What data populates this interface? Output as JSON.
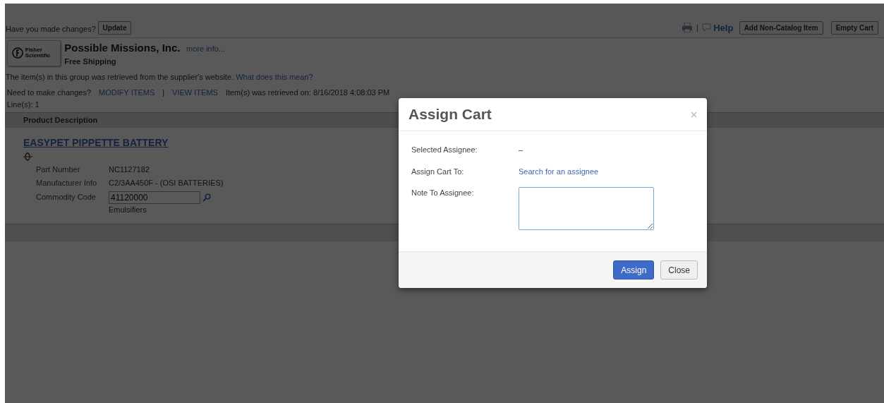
{
  "toolbar": {
    "prompt": "Have you made changes?",
    "update_button": "Update",
    "separator": "|",
    "help_link": "Help",
    "buttons": [
      "Add Non-Catalog Item",
      "Empty Cart"
    ]
  },
  "supplier": {
    "logo_text": "Fisher Scientific",
    "name": "Possible Missions, Inc.",
    "more_link": "more info...",
    "shipping": "Free Shipping"
  },
  "notice": {
    "text": "The item(s) in this group was retrieved from the supplier's website.",
    "link": "What does this mean?"
  },
  "changes": {
    "prompt": "Need to make changes?",
    "links": [
      "MODIFY ITEMS",
      "VIEW ITEMS"
    ],
    "separator": "|",
    "retrieved": "Item(s) was retrieved on: 8/16/2018 4:08:03 PM"
  },
  "lines": "Line(s): 1",
  "table": {
    "columns": [
      "Product Description"
    ]
  },
  "product": {
    "title": "EASYPET PIPPETTE BATTERY",
    "details": [
      {
        "label": "Part Number",
        "value": "NC1127182",
        "kind": "text"
      },
      {
        "label": "Manufacturer Info",
        "value": "C2/3AA450F - (OSI BATTERIES)",
        "kind": "text"
      },
      {
        "label": "Commodity Code",
        "value": "41120000",
        "kind": "field",
        "note": "Emulsifiers"
      }
    ]
  },
  "dialog": {
    "title": "Assign Cart",
    "rows": [
      {
        "label": "Selected Assignee:",
        "value": "–",
        "kind": "text"
      },
      {
        "label": "Assign Cart To:",
        "value": "Search for an assignee",
        "kind": "link"
      },
      {
        "label": "Note To Assignee:",
        "kind": "textarea"
      }
    ],
    "buttons": [
      {
        "label": "Assign",
        "kind": "primary"
      },
      {
        "label": "Close",
        "kind": "secondary"
      }
    ]
  }
}
